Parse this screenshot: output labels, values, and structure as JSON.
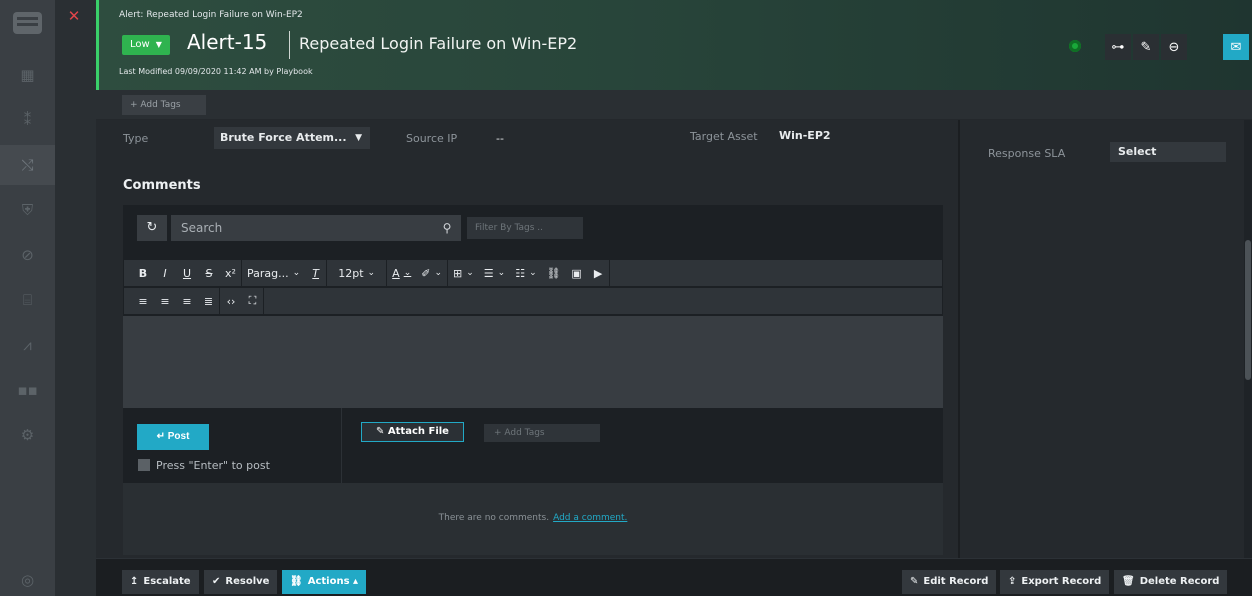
{
  "header": {
    "breadcrumb": "Alert: Repeated Login Failure on Win-EP2",
    "severity": "Low",
    "alert_id": "Alert-15",
    "title": "Repeated Login Failure on Win-EP2",
    "last_modified": "Last Modified 09/09/2020 11:42 AM by Playbook"
  },
  "tags": {
    "add_label": "+ Add Tags"
  },
  "fields": {
    "type_label": "Type",
    "type_value": "Brute Force Attem...",
    "source_ip_label": "Source IP",
    "source_ip_value": "--",
    "target_asset_label": "Target Asset",
    "target_asset_value": "Win-EP2"
  },
  "comments": {
    "title": "Comments",
    "search_placeholder": "Search",
    "filter_placeholder": "Filter By Tags ..",
    "toolbar": {
      "paragraph": "Parag...",
      "font_size": "12pt"
    },
    "post_label": "Post",
    "press_enter_label": "Press \"Enter\" to post",
    "attach_label": "Attach File",
    "add_tags_placeholder": "+ Add Tags",
    "empty_text": "There are no comments.",
    "add_comment_link": "Add a comment."
  },
  "right_panel": {
    "sla_label": "Response SLA",
    "sla_value": "Select"
  },
  "footer": {
    "escalate": "Escalate",
    "resolve": "Resolve",
    "actions": "Actions",
    "edit_record": "Edit Record",
    "export_record": "Export Record",
    "delete_record": "Delete Record"
  },
  "colors": {
    "accent": "#22a9c6",
    "severity_low": "#2fb34f",
    "header_start": "#2e4d3f",
    "close_red": "#e0454a"
  }
}
